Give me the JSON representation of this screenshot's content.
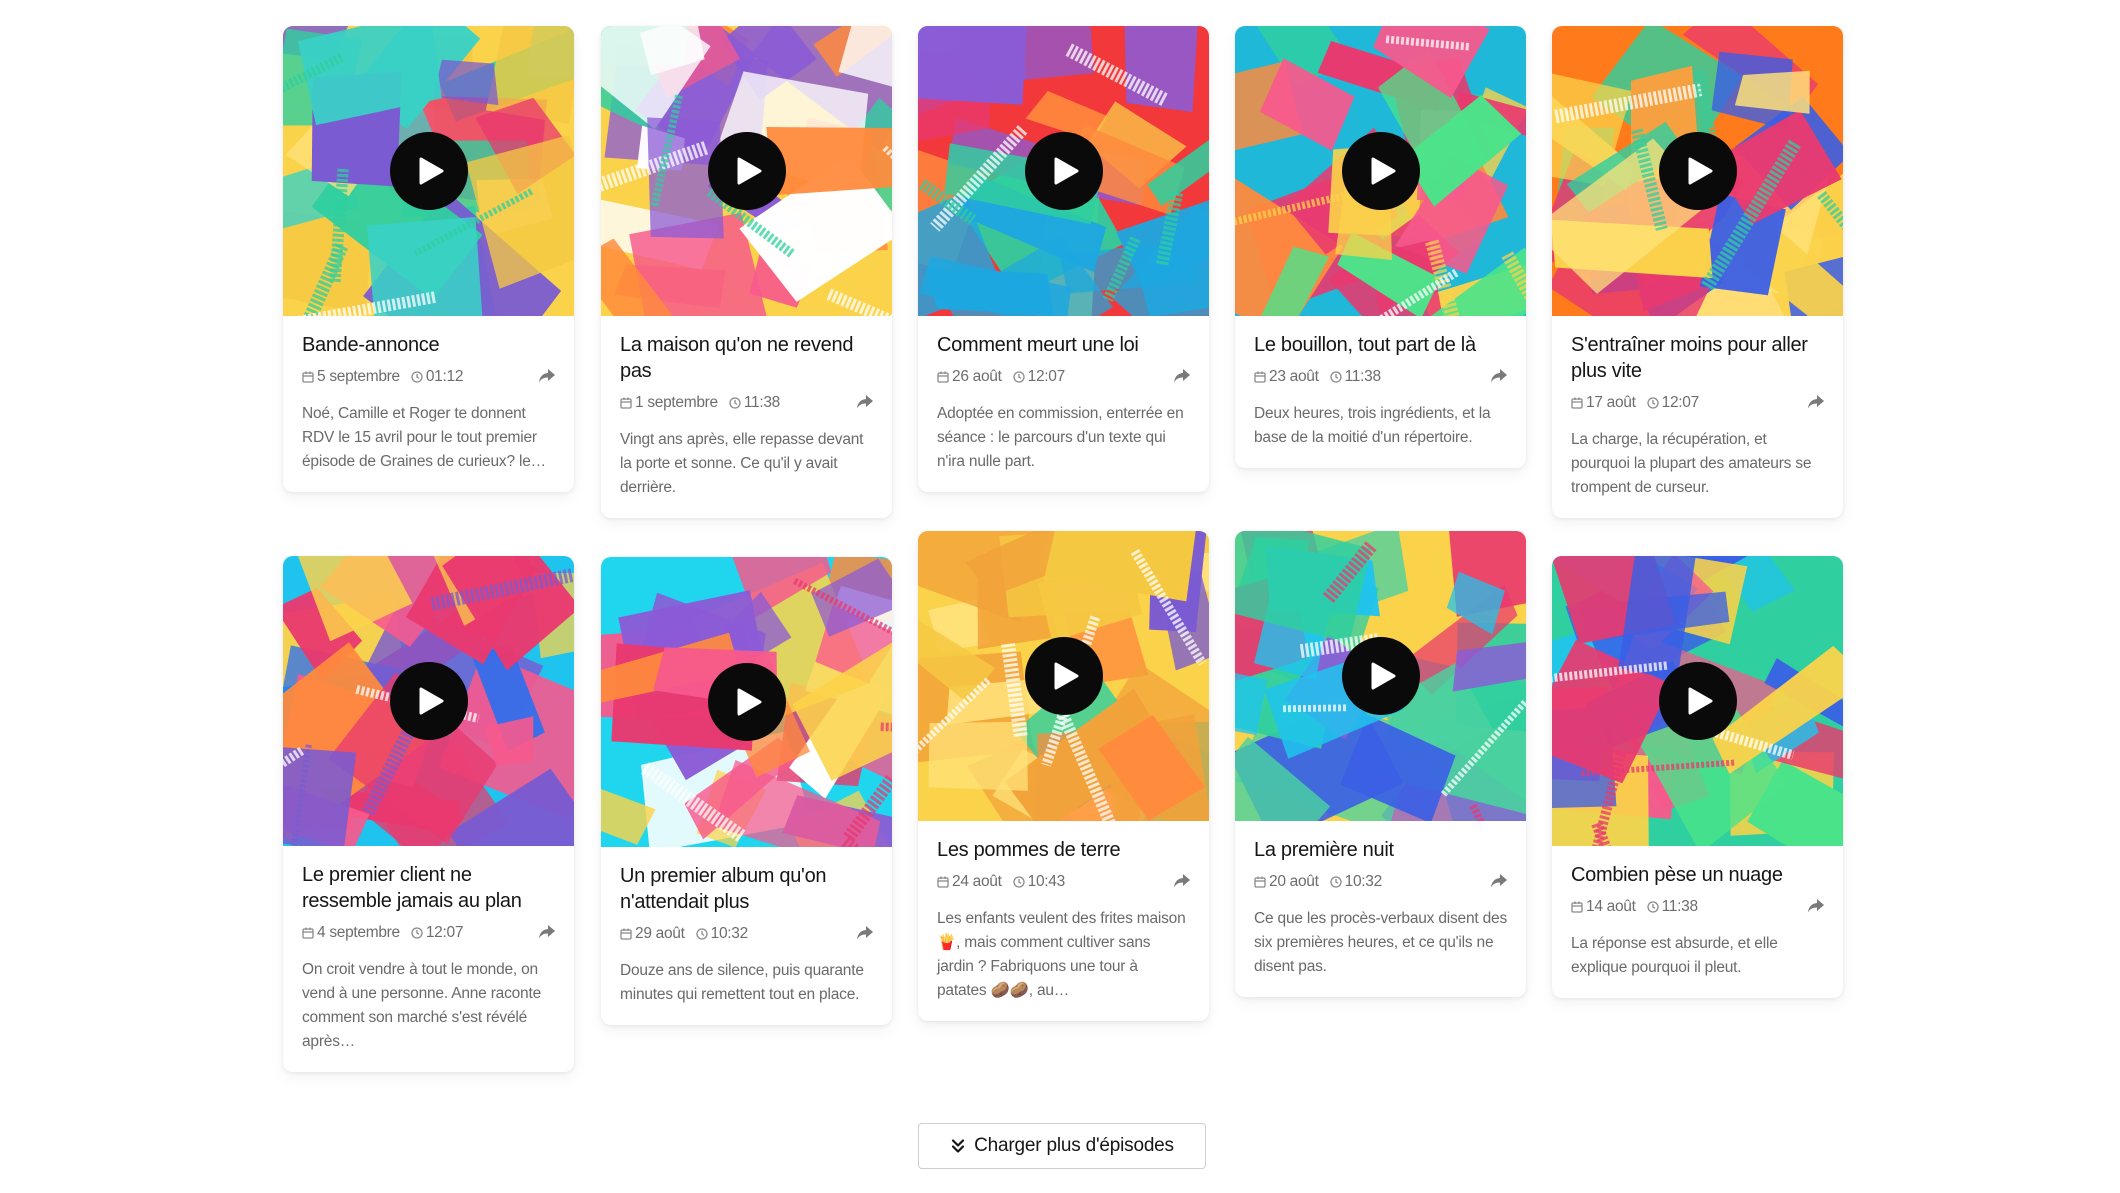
{
  "icons": {
    "date": "calendar-icon",
    "time": "clock-icon",
    "share": "share-arrow-icon",
    "play": "play-icon",
    "load_more": "double-chevron-down-icon"
  },
  "colors": {
    "play_button": "#0a0a0a",
    "title": "#161616",
    "meta": "#6d6d6d",
    "description": "#6a6a6a"
  },
  "episodes": [
    {
      "title": "Bande-annonce",
      "date": "5 septembre",
      "time": "01:12",
      "description": "Noé, Camille et Roger te donnent RDV le 15 avril pour le tout premier épisode de Graines de curieux? le…",
      "palette": [
        "#fbd34a",
        "#f5c842",
        "#2fcf9f",
        "#e9396f",
        "#7a5bd1",
        "#ffe27a",
        "#39d1c6"
      ]
    },
    {
      "title": "La maison qu'on ne revend pas",
      "date": "1 septembre",
      "time": "11:38",
      "description": "Vingt ans après, elle repasse devant la porte et sonne. Ce qu'il y avait derrière.",
      "palette": [
        "#fbd34a",
        "#f7598d",
        "#2fcf9f",
        "#ff8a3d",
        "#8b5bd6",
        "#ffffff",
        "#4ad1a0"
      ]
    },
    {
      "title": "Comment meurt une loi",
      "date": "26 août",
      "time": "12:07",
      "description": "Adoptée en commission, enterrée en séance : le parcours d'un texte qui n'ira nulle part.",
      "palette": [
        "#f2383a",
        "#fbd34a",
        "#2fcf9f",
        "#1da7e0",
        "#e9396f",
        "#8b5bd6",
        "#ff8a3d"
      ]
    },
    {
      "title": "Le bouillon, tout part de là",
      "date": "23 août",
      "time": "11:38",
      "description": "Deux heures, trois ingrédients, et la base de la moitié d'un répertoire.",
      "palette": [
        "#1fb8d9",
        "#f7598d",
        "#fbd34a",
        "#2fcf9f",
        "#ff8a3d",
        "#e9396f",
        "#4be38a"
      ]
    },
    {
      "title": "S'entraîner moins pour aller plus vite",
      "date": "17 août",
      "time": "12:07",
      "description": "La charge, la récupération, et pourquoi la plupart des amateurs se trompent de curseur.",
      "palette": [
        "#ff7a1a",
        "#fbd34a",
        "#2fcf9f",
        "#3a5ee6",
        "#e9396f",
        "#ffe27a",
        "#ff9f3d"
      ]
    },
    {
      "title": "Le premier client ne ressemble jamais au plan",
      "date": "4 septembre",
      "time": "12:07",
      "description": "On croit vendre à tout le monde, on vend à une personne. Anne raconte comment son marché s'est révélé après…",
      "palette": [
        "#1fc4ee",
        "#e9396f",
        "#7a5bd1",
        "#fbd34a",
        "#ff8a3d",
        "#2b6ff0",
        "#f7598d"
      ]
    },
    {
      "title": "Un premier album qu'on n'attendait plus",
      "date": "29 août",
      "time": "10:32",
      "description": "Douze ans de silence, puis quarante minutes qui remettent tout en place.",
      "palette": [
        "#1fd6ee",
        "#ff8a3d",
        "#e9396f",
        "#8b5bd6",
        "#fbd34a",
        "#f7598d",
        "#ffffff"
      ]
    },
    {
      "title": "Les pommes de terre",
      "date": "24 août",
      "time": "10:43",
      "description": "Les enfants veulent des frites maison 🍟, mais comment cultiver sans jardin ? Fabriquons une tour à patates 🥔🥔, au…",
      "palette": [
        "#fbd34a",
        "#f5c842",
        "#2fcf9f",
        "#ff8a3d",
        "#7a5bd1",
        "#ffe27a",
        "#f2a23a"
      ]
    },
    {
      "title": "La première nuit",
      "date": "20 août",
      "time": "10:32",
      "description": "Ce que les procès-verbaux disent des six premières heures, et ce qu'ils ne disent pas.",
      "palette": [
        "#fbd34a",
        "#3a5ee6",
        "#e9396f",
        "#2fcf9f",
        "#1fc4ee",
        "#8b5bd6",
        "#4ad1a0"
      ]
    },
    {
      "title": "Combien pèse un nuage",
      "date": "14 août",
      "time": "11:38",
      "description": "La réponse est absurde, et elle explique pourquoi il pleut.",
      "palette": [
        "#2fcf9f",
        "#3a5ee6",
        "#e9396f",
        "#1fc4ee",
        "#fbd34a",
        "#4be38a",
        "#f7598d"
      ]
    }
  ],
  "load_more_label": "Charger plus d'épisodes"
}
